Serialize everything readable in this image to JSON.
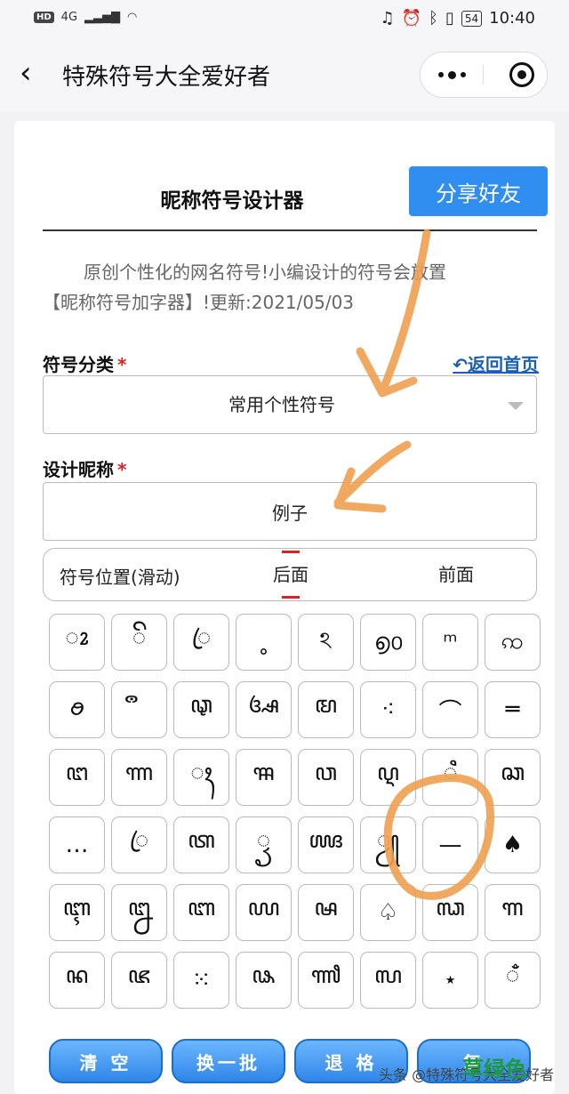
{
  "status_bar": {
    "hd": "HD",
    "network": "4G",
    "battery": "54",
    "time": "10:40"
  },
  "nav": {
    "title": "特殊符号大全爱好者"
  },
  "header": {
    "title": "昵称符号设计器",
    "share_label": "分享好友"
  },
  "intro": {
    "line1": "原创个性化的网名符号!小编设计的符号会放置",
    "line2": "【昵称符号加字器】!更新:2021/05/03"
  },
  "category": {
    "label": "符号分类",
    "required": "*",
    "home_link": "↶返回首页",
    "selected": "常用个性符号"
  },
  "nickname": {
    "label": "设计昵称",
    "required": "*",
    "value": "例子"
  },
  "position": {
    "label": "符号位置(滑动)",
    "after": "后面",
    "before": "前面"
  },
  "symbols": [
    "◌ꦴ",
    "ꦼ",
    "ꦿ",
    "˳",
    "ঽ",
    "൭൦",
    "ᵐ",
    "ꩡ",
    "ꪮ",
    "ຶ",
    "ꦡ",
    "ꦄ",
    "ꦩ",
    "⁖",
    "⌒",
    "═",
    "ꦔ",
    "ꦟ",
    "ꦃ",
    "ꦯ",
    "ꦮ",
    "ꦉ",
    "ꦶ",
    "ꦕ",
    "…",
    "ꦿ",
    "ꦠ",
    "ꦽ",
    "ꦖ",
    "ꦾ",
    "—",
    "♠",
    "ꦇ",
    "ꦊ",
    "ꦧ",
    "ꦪ",
    "ꦰ",
    "♤",
    "ꦓ",
    "ꦒ",
    "ꦤ",
    "ꦗ",
    "⁙",
    "ꦦ",
    "ꦬ",
    "ꦭ",
    "⋆",
    "ꦀ"
  ],
  "buttons": {
    "clear": "清 空",
    "swap": "换一批",
    "backspace": "退 格",
    "copy": "复"
  },
  "watermark": {
    "text": "头条 @特殊符号大全爱好者",
    "green": "草绿色"
  }
}
